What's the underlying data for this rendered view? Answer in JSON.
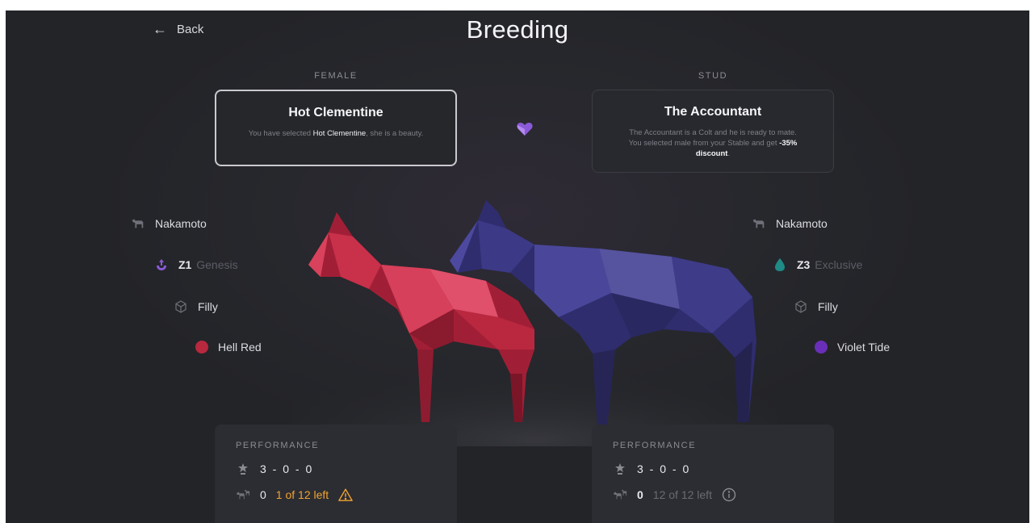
{
  "header": {
    "back_label": "Back",
    "title": "Breeding"
  },
  "female": {
    "column_label": "FEMALE",
    "name": "Hot Clementine",
    "desc_pre": "You have selected ",
    "desc_name": "Hot Clementine",
    "desc_post": ", she is a beauty.",
    "breed": "Nakamoto",
    "zone": "Z1",
    "zone_type": "Genesis",
    "gender": "Filly",
    "color_name": "Hell Red",
    "color_hex": "#b8283e",
    "performance": {
      "label": "PERFORMANCE",
      "record": "3 - 0 - 0",
      "offspring": "0",
      "left_text": "1 of 12 left"
    }
  },
  "stud": {
    "column_label": "STUD",
    "name": "The Accountant",
    "desc_line1": "The Accountant is a Colt and he is ready to mate.",
    "desc_line2": "You selected male from your Stable and get ",
    "desc_discount": "-35% discount",
    "desc_end": ".",
    "breed": "Nakamoto",
    "zone": "Z3",
    "zone_type": "Exclusive",
    "gender": "Filly",
    "color_name": "Violet Tide",
    "color_hex": "#6a2fb8",
    "performance": {
      "label": "PERFORMANCE",
      "record": "3 - 0 - 0",
      "offspring": "0",
      "left_text": "12 of 12 left"
    }
  },
  "colors": {
    "accent_purple": "#8a5ad8",
    "warning_orange": "#f0a330",
    "background": "#27282d"
  }
}
